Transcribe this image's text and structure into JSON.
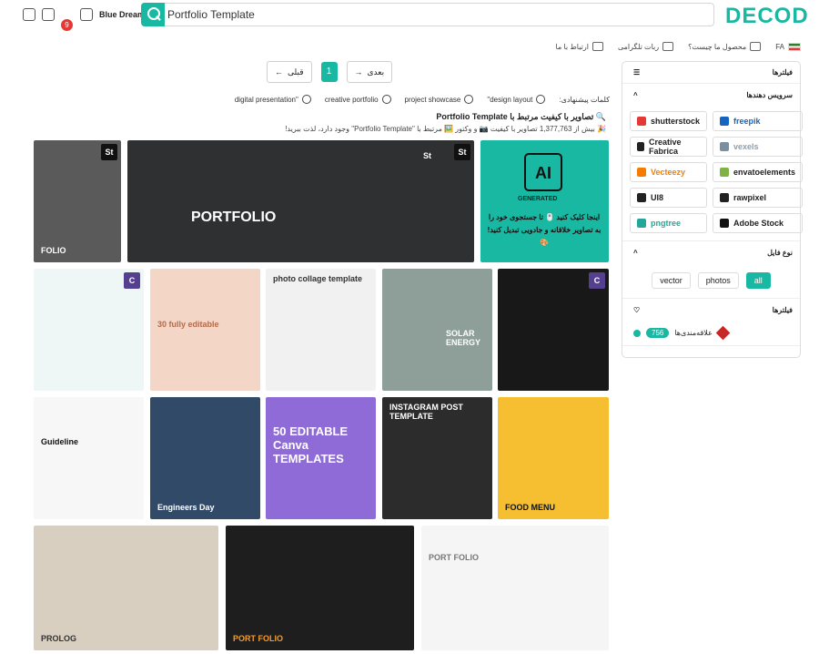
{
  "header": {
    "logo": "DECOD",
    "search_value": "Portfolio Template",
    "user_name": "Blue Dream",
    "notifications": "9"
  },
  "subnav": {
    "language": "FA",
    "what_is": "محصول ما چیست؟",
    "telegram": "ربات تلگرامی",
    "contact": "ارتباط با ما"
  },
  "pager": {
    "prev": "قبلی",
    "page": "1",
    "next": "بعدی"
  },
  "suggestions": {
    "label": "کلمات پیشنهادی:",
    "items": [
      "design layout\"",
      "project showcase",
      "creative portfolio",
      "\"digital presentation"
    ]
  },
  "results": {
    "heading": "🔍 تصاویر با کیفیت مرتبط با  Portfolio Template",
    "subheading": "🎉 بیش از 1,377,763 تصاویر با کیفیت 📷 و وکتور 🖼️ مرتبط با \"Portfolio Template\" وجود دارد، لذت ببرید!"
  },
  "cards": [
    {
      "label": "FOLIO"
    },
    {
      "label": "PORTFOLIO"
    },
    {
      "label": "St"
    },
    {
      "label": "GENERATED",
      "ai": "AI",
      "text": "اینجا کلیک کنید 🖱️ تا جستجوی خود را به تصاویر خلاقانه و جادویی تبدیل کنید! 🎨"
    },
    {
      "label": "C"
    },
    {
      "label": "30 fully editable"
    },
    {
      "label": "photo collage template"
    },
    {
      "label": "SOLAR ENERGY"
    },
    {
      "label": "C"
    },
    {
      "label": "Guideline"
    },
    {
      "label": "Engineers Day"
    },
    {
      "label": "50 EDITABLE Canva TEMPLATES"
    },
    {
      "label": "INSTAGRAM POST TEMPLATE"
    },
    {
      "label": "FOOD MENU"
    },
    {
      "label": "PROLOG"
    },
    {
      "label": "PORT FOLIO"
    },
    {
      "label": "PORT FOLIO"
    }
  ],
  "sidebar": {
    "filters": "فیلترها",
    "providers": "سرویس دهندها",
    "sources": [
      "shutterstock",
      "freepik",
      "Creative Fabrica",
      "vexels",
      "Vecteezy",
      "envatoelements",
      "UI8",
      "rawpixel",
      "pngtree",
      "Adobe Stock"
    ],
    "file_type": "نوع فایل",
    "types": [
      "vector",
      "photos",
      "all"
    ],
    "filters2": "فیلترها",
    "favorites": "علاقه‌مندی‌ها",
    "favorites_count": "756"
  }
}
